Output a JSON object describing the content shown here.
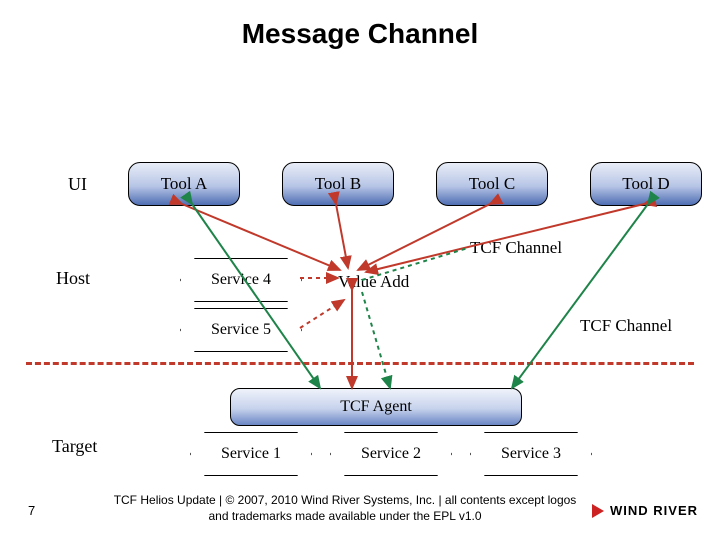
{
  "title": "Message Channel",
  "rows": {
    "ui": "UI",
    "host": "Host",
    "target": "Target"
  },
  "tools": {
    "a": "Tool A",
    "b": "Tool B",
    "c": "Tool C",
    "d": "Tool D"
  },
  "services": {
    "s1": "Service 1",
    "s2": "Service 2",
    "s3": "Service 3",
    "s4": "Service 4",
    "s5": "Service 5"
  },
  "agent": "TCF Agent",
  "value_add": "Value Add",
  "channel_label": "TCF Channel",
  "footer": "TCF Helios Update | © 2007, 2010 Wind River Systems, Inc. | all contents except logos and trademarks made available under the EPL v1.0",
  "page": "7",
  "logo": "WIND RIVER"
}
